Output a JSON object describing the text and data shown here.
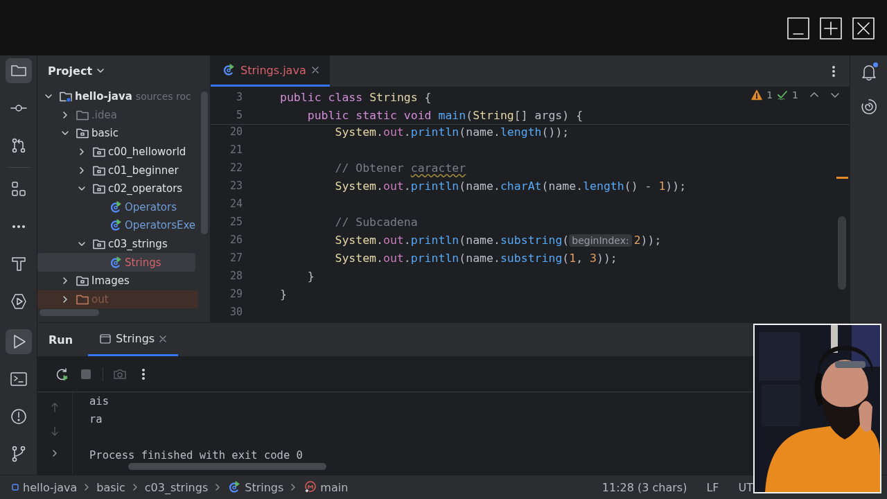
{
  "tool_strip": {
    "top": [
      {
        "kind": "project",
        "selected": true
      },
      {
        "kind": "commit",
        "selected": false
      },
      {
        "kind": "pull-requests",
        "selected": false
      },
      {
        "kind": "structure",
        "selected": false
      },
      {
        "kind": "more",
        "selected": false
      },
      {
        "kind": "build",
        "selected": false
      },
      {
        "kind": "services",
        "selected": false
      }
    ],
    "bottom": [
      {
        "kind": "run",
        "selected": true
      },
      {
        "kind": "terminal",
        "selected": false
      },
      {
        "kind": "problems",
        "selected": false
      },
      {
        "kind": "git",
        "selected": false
      }
    ]
  },
  "right_strip": [
    {
      "kind": "notifications",
      "badge": true
    },
    {
      "kind": "ai-assistant"
    }
  ],
  "project_panel": {
    "title": "Project",
    "tree": [
      {
        "label": "hello-java",
        "kind": "module",
        "secondary": "sources roc",
        "expanded": true,
        "selected": false,
        "children": [
          {
            "label": ".idea",
            "kind": "ignored",
            "expanded": false,
            "selected": false
          },
          {
            "label": "basic",
            "kind": "package",
            "expanded": true,
            "selected": false,
            "children": [
              {
                "label": "c00_helloworld",
                "kind": "package",
                "expanded": false,
                "selected": false
              },
              {
                "label": "c01_beginner",
                "kind": "package",
                "expanded": false,
                "selected": false
              },
              {
                "label": "c02_operators",
                "kind": "package",
                "expanded": true,
                "selected": false,
                "children": [
                  {
                    "label": "Operators",
                    "kind": "class",
                    "color": "#6f9ed9",
                    "selected": false
                  },
                  {
                    "label": "OperatorsExe",
                    "kind": "class",
                    "color": "#6f9ed9",
                    "selected": false
                  }
                ]
              },
              {
                "label": "c03_strings",
                "kind": "package",
                "expanded": true,
                "selected": false,
                "children": [
                  {
                    "label": "Strings",
                    "kind": "class",
                    "color": "#d6636b",
                    "selected": true
                  }
                ]
              }
            ]
          },
          {
            "label": "Images",
            "kind": "package",
            "expanded": false,
            "selected": false
          },
          {
            "label": "out",
            "kind": "excluded",
            "expanded": false,
            "selected": false
          }
        ]
      }
    ]
  },
  "editor": {
    "tabs": [
      {
        "label": "Strings.java",
        "color": "#d6636b",
        "selected": true
      }
    ],
    "inspections": {
      "warnings": "1",
      "weak_warnings": "1"
    },
    "sticky_lines": [
      {
        "number": "3",
        "kind": "top",
        "tokens": [
          {
            "text": "public class ",
            "kind": "kw"
          },
          {
            "text": "Strings",
            "kind": "type"
          },
          {
            "text": " {",
            "kind": "plain"
          }
        ]
      },
      {
        "number": "5",
        "kind": "member",
        "tokens": [
          {
            "text": "public static void ",
            "kind": "kw"
          },
          {
            "text": "main",
            "kind": "method"
          },
          {
            "text": "(",
            "kind": "plain"
          },
          {
            "text": "String",
            "kind": "type"
          },
          {
            "text": "[] args) {",
            "kind": "plain"
          }
        ]
      }
    ],
    "lines": [
      {
        "number": "20",
        "kind": "statement",
        "tokens": [
          {
            "text": "System",
            "kind": "type"
          },
          {
            "text": ".",
            "kind": "plain"
          },
          {
            "text": "out",
            "kind": "field"
          },
          {
            "text": ".",
            "kind": "plain"
          },
          {
            "text": "println",
            "kind": "method"
          },
          {
            "text": "(name.",
            "kind": "plain"
          },
          {
            "text": "length",
            "kind": "method"
          },
          {
            "text": "());",
            "kind": "plain"
          }
        ]
      },
      {
        "number": "21"
      },
      {
        "number": "22",
        "kind": "statement",
        "tokens": [
          {
            "text": "// Obtener ",
            "kind": "comment"
          },
          {
            "text": "caracter",
            "kind": "typo"
          }
        ]
      },
      {
        "number": "23",
        "kind": "statement",
        "tokens": [
          {
            "text": "System",
            "kind": "type"
          },
          {
            "text": ".",
            "kind": "plain"
          },
          {
            "text": "out",
            "kind": "field"
          },
          {
            "text": ".",
            "kind": "plain"
          },
          {
            "text": "println",
            "kind": "method"
          },
          {
            "text": "(name.",
            "kind": "plain"
          },
          {
            "text": "charAt",
            "kind": "method"
          },
          {
            "text": "(name.",
            "kind": "plain"
          },
          {
            "text": "length",
            "kind": "method"
          },
          {
            "text": "() - ",
            "kind": "plain"
          },
          {
            "text": "1",
            "kind": "num"
          },
          {
            "text": "));",
            "kind": "plain"
          }
        ]
      },
      {
        "number": "24"
      },
      {
        "number": "25",
        "kind": "statement",
        "tokens": [
          {
            "text": "// Subcadena",
            "kind": "comment"
          }
        ]
      },
      {
        "number": "26",
        "kind": "statement",
        "tokens": [
          {
            "text": "System",
            "kind": "type"
          },
          {
            "text": ".",
            "kind": "plain"
          },
          {
            "text": "out",
            "kind": "field"
          },
          {
            "text": ".",
            "kind": "plain"
          },
          {
            "text": "println",
            "kind": "method"
          },
          {
            "text": "(name.",
            "kind": "plain"
          },
          {
            "text": "substring",
            "kind": "method"
          },
          {
            "text": "(",
            "kind": "plain"
          },
          {
            "text": "beginIndex:",
            "kind": "hint"
          },
          {
            "text": "2",
            "kind": "num"
          },
          {
            "text": "));",
            "kind": "plain"
          }
        ]
      },
      {
        "number": "27",
        "kind": "statement",
        "tokens": [
          {
            "text": "System",
            "kind": "type"
          },
          {
            "text": ".",
            "kind": "plain"
          },
          {
            "text": "out",
            "kind": "field"
          },
          {
            "text": ".",
            "kind": "plain"
          },
          {
            "text": "println",
            "kind": "method"
          },
          {
            "text": "(name.",
            "kind": "plain"
          },
          {
            "text": "substring",
            "kind": "method"
          },
          {
            "text": "(",
            "kind": "plain"
          },
          {
            "text": "1",
            "kind": "num"
          },
          {
            "text": ", ",
            "kind": "plain"
          },
          {
            "text": "3",
            "kind": "num"
          },
          {
            "text": "));",
            "kind": "plain"
          }
        ]
      },
      {
        "number": "28",
        "kind": "member",
        "tokens": [
          {
            "text": "}",
            "kind": "plain"
          }
        ]
      },
      {
        "number": "29",
        "kind": "top",
        "tokens": [
          {
            "text": "}",
            "kind": "plain"
          }
        ]
      },
      {
        "number": "30"
      }
    ]
  },
  "run_panel": {
    "title": "Run",
    "tabs": [
      {
        "label": "Strings",
        "selected": true
      }
    ],
    "toolbar": [
      {
        "kind": "rerun",
        "disabled": false
      },
      {
        "kind": "stop",
        "disabled": true
      },
      {
        "kind": "screenshot",
        "disabled": true
      },
      {
        "kind": "more",
        "disabled": false
      }
    ],
    "output": [
      "ais",
      "ra"
    ],
    "exit_message": "Process finished with exit code 0"
  },
  "status_bar": {
    "breadcrumbs": [
      {
        "label": "hello-java",
        "kind": "module"
      },
      {
        "label": "basic",
        "kind": "folder"
      },
      {
        "label": "c03_strings",
        "kind": "folder"
      },
      {
        "label": "Strings",
        "kind": "class"
      },
      {
        "label": "main",
        "kind": "method"
      }
    ],
    "position": "11:28 (3 chars)",
    "line_separator": "LF",
    "encoding": "UT"
  }
}
